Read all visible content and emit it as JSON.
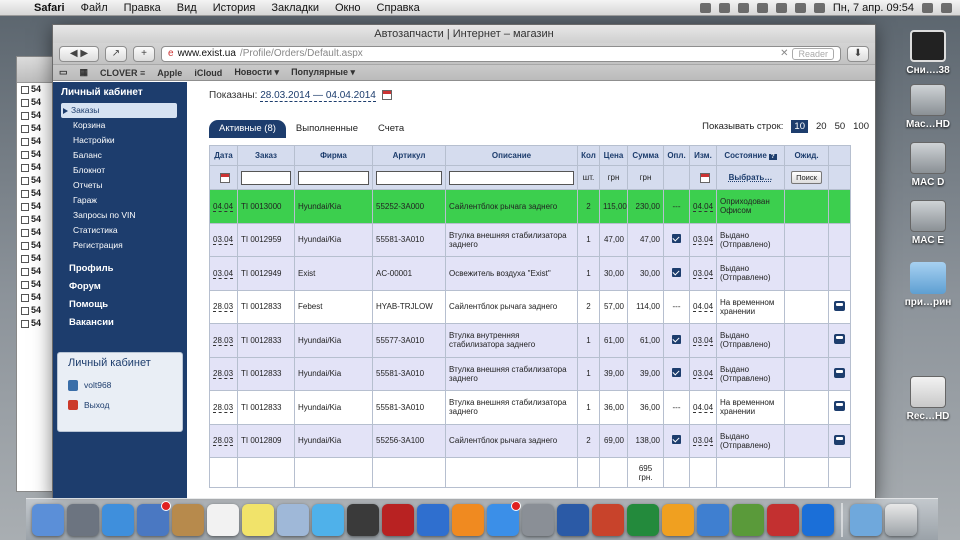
{
  "menubar": {
    "app": "Safari",
    "items": [
      "Файл",
      "Правка",
      "Вид",
      "История",
      "Закладки",
      "Окно",
      "Справка"
    ],
    "clock": "Пн, 7 апр.  09:54"
  },
  "desktop": {
    "icons": [
      {
        "label": "Сни….38",
        "icon": "screenshot-icon"
      },
      {
        "label": "Mac…HD",
        "icon": "hard-drive-icon"
      },
      {
        "label": "MAC D",
        "icon": "hard-drive-icon"
      },
      {
        "label": "MAC E",
        "icon": "hard-drive-icon"
      },
      {
        "label": "при…рин",
        "icon": "folder-icon"
      },
      {
        "label": "Rec…HD",
        "icon": "removable-drive-icon"
      }
    ],
    "bg_window_rows": [
      "54",
      "54",
      "54",
      "54",
      "54",
      "54",
      "54",
      "54",
      "54",
      "54",
      "54",
      "54",
      "54",
      "54",
      "54",
      "54",
      "54",
      "54",
      "54"
    ]
  },
  "browser": {
    "title": "Автозапчасти | Интернет – магазин",
    "url_host": "www.exist.ua",
    "url_path": "/Profile/Orders/Default.aspx",
    "reader": "Reader",
    "bookmarks": [
      "CLOVER ≡",
      "Apple",
      "iCloud",
      "Новости ▾",
      "Популярные ▾"
    ]
  },
  "sidebar": {
    "header": "Личный кабинет",
    "items": [
      "Заказы",
      "Корзина",
      "Настройки",
      "Баланс",
      "Блокнот",
      "Отчеты",
      "Гараж",
      "Запросы по VIN",
      "Статистика",
      "Регистрация"
    ],
    "big_links": [
      "Профиль",
      "Форум",
      "Помощь",
      "Вакансии"
    ],
    "box": {
      "title": "Личный кабинет",
      "user": "volt968",
      "logout": "Выход"
    }
  },
  "content": {
    "shown_label": "Показаны:",
    "date_range": "28.03.2014 — 04.04.2014",
    "tabs": [
      "Активные (8)",
      "Выполненные",
      "Счета"
    ],
    "rows_label": "Показывать строк:",
    "row_options": [
      "10",
      "20",
      "50",
      "100"
    ],
    "selected_rows": "10"
  },
  "table": {
    "headers": [
      "Дата",
      "Заказ",
      "Фирма",
      "Артикул",
      "Описание",
      "Кол",
      "Цена",
      "Сумма",
      "Опл.",
      "Изм.",
      "Состояние",
      "Ожид."
    ],
    "subheaders": {
      "qty": "шт.",
      "price": "грн",
      "sum": "грн"
    },
    "state_select": "Выбрать…",
    "search_button": "Поиск",
    "rows": [
      {
        "date": "04.04",
        "order": "TI 0013000",
        "firm": "Hyundai/Kia",
        "article": "55252-3A000",
        "desc": "Сайлентблок рычага заднего",
        "qty": "2",
        "price": "115,00",
        "sum": "230,00",
        "paid": "---",
        "changed": "04.04",
        "state": "Оприходован Офисом",
        "car": false,
        "style": "hl"
      },
      {
        "date": "03.04",
        "order": "TI 0012959",
        "firm": "Hyundai/Kia",
        "article": "55581-3A010",
        "desc": "Втулка внешняя стабилизатора заднего",
        "qty": "1",
        "price": "47,00",
        "sum": "47,00",
        "paid": "check",
        "changed": "03.04",
        "state": "Выдано (Отправлено)",
        "car": false,
        "style": "even"
      },
      {
        "date": "03.04",
        "order": "TI 0012949",
        "firm": "Exist",
        "article": "AC-00001",
        "desc": "Освежитель воздуха \"Exist\"",
        "qty": "1",
        "price": "30,00",
        "sum": "30,00",
        "paid": "check",
        "changed": "03.04",
        "state": "Выдано (Отправлено)",
        "car": false,
        "style": "even"
      },
      {
        "date": "28.03",
        "order": "TI 0012833",
        "firm": "Febest",
        "article": "HYAB-TRJLOW",
        "desc": "Сайлентблок рычага заднего",
        "qty": "2",
        "price": "57,00",
        "sum": "114,00",
        "paid": "---",
        "changed": "04.04",
        "state": "На временном хранении",
        "car": true,
        "style": "odd"
      },
      {
        "date": "28.03",
        "order": "TI 0012833",
        "firm": "Hyundai/Kia",
        "article": "55577-3A010",
        "desc": "Втулка внутренняя стабилизатора заднего",
        "qty": "1",
        "price": "61,00",
        "sum": "61,00",
        "paid": "check",
        "changed": "03.04",
        "state": "Выдано (Отправлено)",
        "car": true,
        "style": "even"
      },
      {
        "date": "28.03",
        "order": "TI 0012833",
        "firm": "Hyundai/Kia",
        "article": "55581-3A010",
        "desc": "Втулка внешняя стабилизатора заднего",
        "qty": "1",
        "price": "39,00",
        "sum": "39,00",
        "paid": "check",
        "changed": "03.04",
        "state": "Выдано (Отправлено)",
        "car": true,
        "style": "even"
      },
      {
        "date": "28.03",
        "order": "TI 0012833",
        "firm": "Hyundai/Kia",
        "article": "55581-3A010",
        "desc": "Втулка внешняя стабилизатора заднего",
        "qty": "1",
        "price": "36,00",
        "sum": "36,00",
        "paid": "---",
        "changed": "04.04",
        "state": "На временном хранении",
        "car": true,
        "style": "odd"
      },
      {
        "date": "28.03",
        "order": "TI 0012809",
        "firm": "Hyundai/Kia",
        "article": "55256-3A100",
        "desc": "Сайлентблок рычага заднего",
        "qty": "2",
        "price": "69,00",
        "sum": "138,00",
        "paid": "check",
        "changed": "03.04",
        "state": "Выдано (Отправлено)",
        "car": true,
        "style": "even"
      }
    ],
    "total": "695 грн."
  },
  "dock": {
    "apps": [
      "finder-icon",
      "launchpad-icon",
      "safari-icon",
      "mail-icon",
      "contacts-icon",
      "calendar-icon",
      "notes-icon",
      "preview-icon",
      "messages-icon",
      "facetime-icon",
      "photo-booth-icon",
      "itunes-icon",
      "ibooks-icon",
      "app-store-icon",
      "system-preferences-icon",
      "word-icon",
      "powerpoint-icon",
      "excel-icon",
      "outlook-icon",
      "lync-icon",
      "remote-desktop-icon",
      "parallels-icon",
      "teamviewer-icon"
    ],
    "colors": [
      "#5b8fd8",
      "#6c7480",
      "#3f8fdc",
      "#4a78c2",
      "#b78a4c",
      "#f2f2f2",
      "#f1e36a",
      "#9fb8d8",
      "#4fb1ea",
      "#3a3a3a",
      "#b82222",
      "#2f6fcf",
      "#f08a20",
      "#3b8fe8",
      "#8a8f96",
      "#2b5aa6",
      "#c8432b",
      "#238a3c",
      "#f0a020",
      "#3f7fd0",
      "#5a9a3a",
      "#c33030",
      "#1b6fd8"
    ],
    "stack": [
      "downloads-icon",
      "trash-icon"
    ]
  }
}
